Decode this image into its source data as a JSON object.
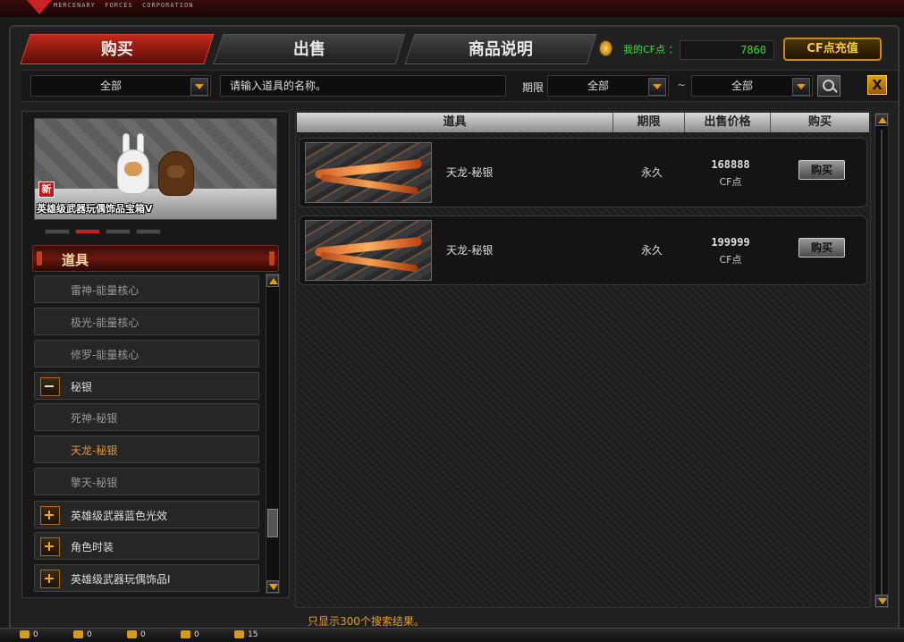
{
  "header": {
    "logo_text": "MERCENARY  FORCES  CORPORATION"
  },
  "tabs": [
    {
      "label": "购买",
      "active": true
    },
    {
      "label": "出售",
      "active": false
    },
    {
      "label": "商品说明",
      "active": false
    }
  ],
  "account": {
    "cf_label": "我的CF点 ：",
    "cf_value": "7860",
    "recharge_label": "CF点充值"
  },
  "filters": {
    "category_value": "全部",
    "search_placeholder": "请输入道具的名称。",
    "period_label": "期限",
    "period_value": "全部",
    "range_separator": "~",
    "sort_value": "全部",
    "close_label": "X"
  },
  "banner": {
    "new_badge": "新",
    "title": "英雄级武器玩偶饰品宝箱V",
    "pager_count": 4,
    "pager_active": 2
  },
  "category": {
    "header": "道具",
    "items": [
      {
        "label": "雷神-能量核心",
        "type": "sub"
      },
      {
        "label": "极光-能量核心",
        "type": "sub"
      },
      {
        "label": "修罗-能量核心",
        "type": "sub"
      },
      {
        "label": "秘银",
        "type": "parent-open"
      },
      {
        "label": "死神-秘银",
        "type": "sub"
      },
      {
        "label": "天龙-秘银",
        "type": "sub-active"
      },
      {
        "label": "擎天-秘银",
        "type": "sub"
      },
      {
        "label": "英雄级武器蓝色光效",
        "type": "parent"
      },
      {
        "label": "角色时装",
        "type": "parent"
      },
      {
        "label": "英雄级武器玩偶饰品Ⅰ",
        "type": "parent"
      }
    ]
  },
  "table": {
    "headers": [
      "道具",
      "期限",
      "出售价格",
      "购买"
    ],
    "rows": [
      {
        "name": "天龙-秘银",
        "period": "永久",
        "price": "168888",
        "unit": "CF点",
        "buy_label": "购买"
      },
      {
        "name": "天龙-秘银",
        "period": "永久",
        "price": "199999",
        "unit": "CF点",
        "buy_label": "购买"
      }
    ]
  },
  "footer": {
    "result_note": "只显示300个搜索结果。",
    "stats": [
      "0",
      "0",
      "0",
      "0",
      "15"
    ]
  },
  "colors": {
    "accent_red": "#c02a1a",
    "cf_green": "#29e12f",
    "gold": "#e09a10",
    "selected_item": "#e89535"
  }
}
